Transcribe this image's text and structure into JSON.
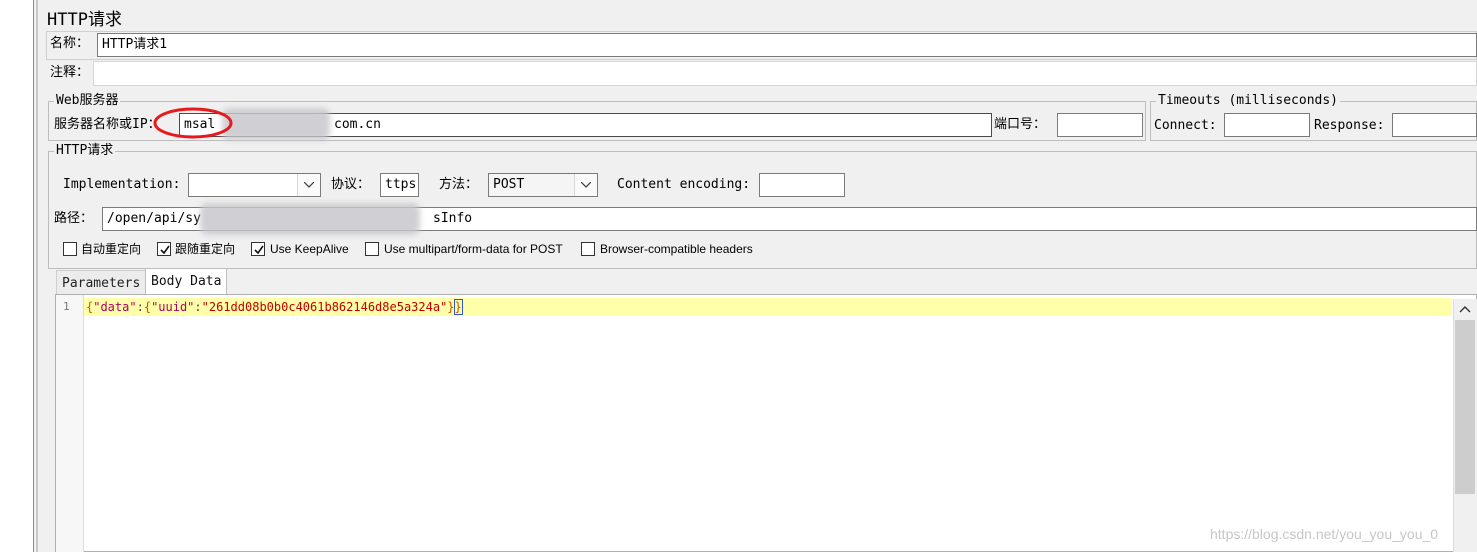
{
  "panel": {
    "title": "HTTP请求"
  },
  "name_field": {
    "label": "名称：",
    "value": "HTTP请求1"
  },
  "comment_field": {
    "label": "注释：",
    "value": ""
  },
  "web_server": {
    "legend": "Web服务器",
    "server_label": "服务器名称或IP：",
    "server_value_start": "msal",
    "server_value_end": "com.cn",
    "port_label": "端口号：",
    "port_value": ""
  },
  "timeouts": {
    "legend": "Timeouts (milliseconds)",
    "connect_label": "Connect:",
    "connect_value": "",
    "response_label": "Response:",
    "response_value": ""
  },
  "http_request": {
    "legend": "HTTP请求",
    "implementation_label": "Implementation:",
    "implementation_value": "",
    "protocol_label": "协议：",
    "protocol_value": "ttps",
    "method_label": "方法：",
    "method_value": "POST",
    "encoding_label": "Content encoding:",
    "encoding_value": "",
    "path_label": "路径：",
    "path_value_start": "/open/api/sy",
    "path_value_end": "sInfo"
  },
  "options": [
    {
      "label": "自动重定向",
      "checked": false
    },
    {
      "label": "跟随重定向",
      "checked": true
    },
    {
      "label": "Use KeepAlive",
      "checked": true
    },
    {
      "label": "Use multipart/form-data for POST",
      "checked": false
    },
    {
      "label": "Browser-compatible headers",
      "checked": false
    }
  ],
  "tabs": [
    {
      "label": "Parameters",
      "active": false
    },
    {
      "label": "Body Data",
      "active": true
    }
  ],
  "body_editor": {
    "line_number": "1",
    "brace_open": "{",
    "k_data": "\"data\"",
    "colon1": ":",
    "brace_inner": "{",
    "k_uuid": "\"uuid\"",
    "colon2": ":",
    "v_uuid": "\"261dd08b0b0c4061b862146d8e5a324a\"",
    "brace_close_inner": "}",
    "brace_close_outer": "}"
  },
  "watermark": "https://blog.csdn.net/you_you_you_0",
  "colors": {
    "annotation_circle": "#e8191c",
    "current_line": "#ffffaa"
  }
}
